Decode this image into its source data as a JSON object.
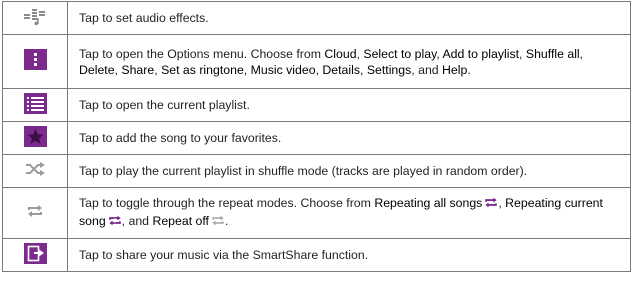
{
  "rows": [
    {
      "icon": "audio-effects-icon",
      "parts": [
        {
          "t": "Tap to set audio effects."
        }
      ]
    },
    {
      "icon": "options-menu-icon",
      "parts": [
        {
          "t": "Tap to open the Options menu. Choose from "
        },
        {
          "t": "Cloud",
          "hl": true
        },
        {
          "t": ", "
        },
        {
          "t": "Select to play",
          "hl": true
        },
        {
          "t": ", "
        },
        {
          "t": "Add to playlist",
          "hl": true
        },
        {
          "t": ", "
        },
        {
          "t": "Shuffle all",
          "hl": true
        },
        {
          "t": ", "
        },
        {
          "t": "Delete",
          "hl": true
        },
        {
          "t": ", "
        },
        {
          "t": "Share",
          "hl": true
        },
        {
          "t": ", "
        },
        {
          "t": "Set as ringtone",
          "hl": true
        },
        {
          "t": ", "
        },
        {
          "t": "Music video",
          "hl": true
        },
        {
          "t": ", "
        },
        {
          "t": "Details, Settings",
          "hl": true
        },
        {
          "t": ", and "
        },
        {
          "t": "Help",
          "hl": true
        },
        {
          "t": "."
        }
      ]
    },
    {
      "icon": "playlist-icon",
      "parts": [
        {
          "t": "Tap to open the current playlist."
        }
      ]
    },
    {
      "icon": "favorite-star-icon",
      "parts": [
        {
          "t": "Tap to add the song to your favorites."
        }
      ]
    },
    {
      "icon": "shuffle-icon",
      "parts": [
        {
          "t": "Tap to play the current playlist in shuffle mode (tracks are played in random order)."
        }
      ]
    },
    {
      "icon": "repeat-icon",
      "parts": [
        {
          "t": "Tap to toggle through the repeat modes. Choose from "
        },
        {
          "t": "Repeating all songs",
          "hl": true
        },
        {
          "icon": "repeat-all-icon"
        },
        {
          "t": ", "
        },
        {
          "t": "Repeating current song",
          "hl": true
        },
        {
          "icon": "repeat-one-icon"
        },
        {
          "t": ", and "
        },
        {
          "t": "Repeat off",
          "hl": true
        },
        {
          "icon": "repeat-off-icon"
        },
        {
          "t": "."
        }
      ]
    },
    {
      "icon": "share-icon",
      "parts": [
        {
          "t": "Tap to share your music via the SmartShare function."
        }
      ]
    }
  ],
  "colors": {
    "accent": "#7d2a8e",
    "grey_icon": "#9b9b9b",
    "border": "#7a7a7a"
  }
}
